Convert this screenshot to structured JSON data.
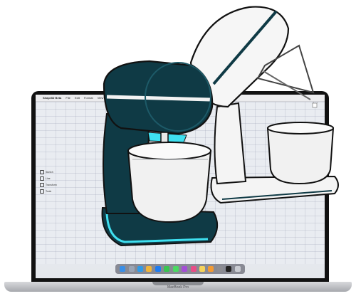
{
  "app": {
    "menu": [
      "Shapr3D Beta",
      "File",
      "Edit",
      "Format",
      "View",
      "Window"
    ],
    "right_status": "⚙ ☰"
  },
  "tools": [
    {
      "label": "Sketch",
      "icon": "sketch-icon"
    },
    {
      "label": "Line",
      "icon": "line-icon"
    },
    {
      "label": "Transform",
      "icon": "transform-icon"
    },
    {
      "label": "Tools",
      "icon": "tools-icon"
    }
  ],
  "dock_icons": [
    {
      "name": "finder-icon",
      "color": "#3a8ee6"
    },
    {
      "name": "launchpad-icon",
      "color": "#9aa4b4"
    },
    {
      "name": "safari-icon",
      "color": "#2f9be8"
    },
    {
      "name": "photos-icon",
      "color": "#f0b53a"
    },
    {
      "name": "app-store-icon",
      "color": "#1f7cf0"
    },
    {
      "name": "facetime-icon",
      "color": "#3ac452"
    },
    {
      "name": "messages-icon",
      "color": "#4cd964"
    },
    {
      "name": "podcasts-icon",
      "color": "#a44fd6"
    },
    {
      "name": "itunes-icon",
      "color": "#e94d87"
    },
    {
      "name": "notes-icon",
      "color": "#f6d35a"
    },
    {
      "name": "pages-icon",
      "color": "#f29a33"
    },
    {
      "name": "settings-icon",
      "color": "#8d8d92"
    },
    {
      "name": "shapr3d-icon",
      "color": "#222222"
    },
    {
      "name": "trash-icon",
      "color": "#c9ccd2"
    }
  ],
  "laptop": {
    "model": "MacBook Pro"
  },
  "colors": {
    "mixer_dark": "#0f3a45",
    "mixer_glow": "#3fe0f0",
    "bowl": "#f2f2f2",
    "outline": "#111111"
  }
}
